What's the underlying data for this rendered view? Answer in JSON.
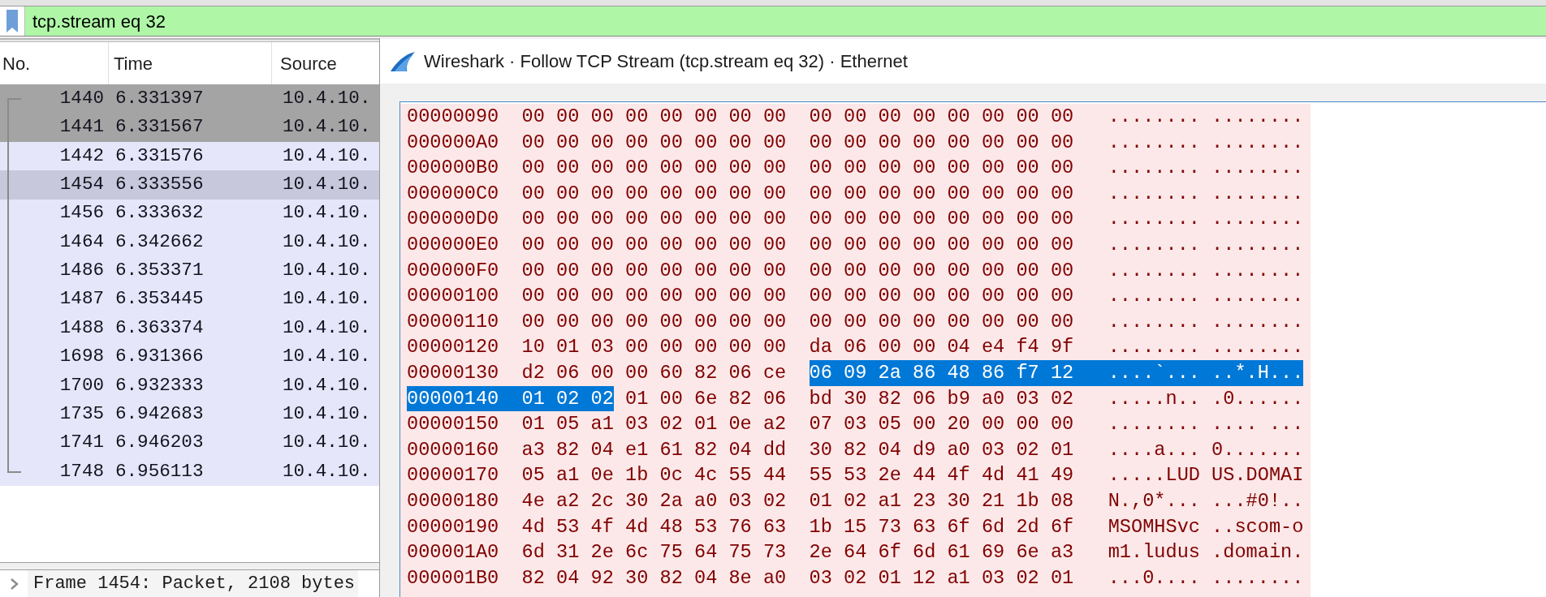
{
  "filter_bar": {
    "value": "tcp.stream eq 32"
  },
  "packet_list": {
    "columns": [
      "No.",
      "Time",
      "Source"
    ],
    "rows": [
      {
        "no": "1440",
        "time": "6.331397",
        "source": "10.4.10.",
        "color": "#a4a4a4"
      },
      {
        "no": "1441",
        "time": "6.331567",
        "source": "10.4.10.",
        "color": "#a4a4a4"
      },
      {
        "no": "1442",
        "time": "6.331576",
        "source": "10.4.10.",
        "color": "#e6e6fa"
      },
      {
        "no": "1454",
        "time": "6.333556",
        "source": "10.4.10.",
        "color": "#c8c8dc"
      },
      {
        "no": "1456",
        "time": "6.333632",
        "source": "10.4.10.",
        "color": "#e6e6fa"
      },
      {
        "no": "1464",
        "time": "6.342662",
        "source": "10.4.10.",
        "color": "#e6e6fa"
      },
      {
        "no": "1486",
        "time": "6.353371",
        "source": "10.4.10.",
        "color": "#e6e6fa"
      },
      {
        "no": "1487",
        "time": "6.353445",
        "source": "10.4.10.",
        "color": "#e6e6fa"
      },
      {
        "no": "1488",
        "time": "6.363374",
        "source": "10.4.10.",
        "color": "#e6e6fa"
      },
      {
        "no": "1698",
        "time": "6.931366",
        "source": "10.4.10.",
        "color": "#e6e6fa"
      },
      {
        "no": "1700",
        "time": "6.932333",
        "source": "10.4.10.",
        "color": "#e6e6fa"
      },
      {
        "no": "1735",
        "time": "6.942683",
        "source": "10.4.10.",
        "color": "#e6e6fa"
      },
      {
        "no": "1741",
        "time": "6.946203",
        "source": "10.4.10.",
        "color": "#e6e6fa"
      },
      {
        "no": "1748",
        "time": "6.956113",
        "source": "10.4.10.",
        "color": "#e6e6fa"
      }
    ]
  },
  "packet_details": {
    "items": [
      {
        "label": "Frame 1454: Packet, 2108 bytes",
        "expanded": false
      }
    ]
  },
  "follow_dialog": {
    "title": "Wireshark · Follow TCP Stream (tcp.stream eq 32) · Ethernet",
    "lines": [
      {
        "offset": {
          "text": "00000090",
          "selected": false
        },
        "hex_a": [
          {
            "text": "00 00 00 00 00 00 00 00",
            "selected": false
          }
        ],
        "hex_b": [
          {
            "text": "00 00 00 00 00 00 00 00",
            "selected": false
          }
        ],
        "ascii": [
          {
            "text": "........ ........",
            "selected": false
          }
        ]
      },
      {
        "offset": {
          "text": "000000A0",
          "selected": false
        },
        "hex_a": [
          {
            "text": "00 00 00 00 00 00 00 00",
            "selected": false
          }
        ],
        "hex_b": [
          {
            "text": "00 00 00 00 00 00 00 00",
            "selected": false
          }
        ],
        "ascii": [
          {
            "text": "........ ........",
            "selected": false
          }
        ]
      },
      {
        "offset": {
          "text": "000000B0",
          "selected": false
        },
        "hex_a": [
          {
            "text": "00 00 00 00 00 00 00 00",
            "selected": false
          }
        ],
        "hex_b": [
          {
            "text": "00 00 00 00 00 00 00 00",
            "selected": false
          }
        ],
        "ascii": [
          {
            "text": "........ ........",
            "selected": false
          }
        ]
      },
      {
        "offset": {
          "text": "000000C0",
          "selected": false
        },
        "hex_a": [
          {
            "text": "00 00 00 00 00 00 00 00",
            "selected": false
          }
        ],
        "hex_b": [
          {
            "text": "00 00 00 00 00 00 00 00",
            "selected": false
          }
        ],
        "ascii": [
          {
            "text": "........ ........",
            "selected": false
          }
        ]
      },
      {
        "offset": {
          "text": "000000D0",
          "selected": false
        },
        "hex_a": [
          {
            "text": "00 00 00 00 00 00 00 00",
            "selected": false
          }
        ],
        "hex_b": [
          {
            "text": "00 00 00 00 00 00 00 00",
            "selected": false
          }
        ],
        "ascii": [
          {
            "text": "........ ........",
            "selected": false
          }
        ]
      },
      {
        "offset": {
          "text": "000000E0",
          "selected": false
        },
        "hex_a": [
          {
            "text": "00 00 00 00 00 00 00 00",
            "selected": false
          }
        ],
        "hex_b": [
          {
            "text": "00 00 00 00 00 00 00 00",
            "selected": false
          }
        ],
        "ascii": [
          {
            "text": "........ ........",
            "selected": false
          }
        ]
      },
      {
        "offset": {
          "text": "000000F0",
          "selected": false
        },
        "hex_a": [
          {
            "text": "00 00 00 00 00 00 00 00",
            "selected": false
          }
        ],
        "hex_b": [
          {
            "text": "00 00 00 00 00 00 00 00",
            "selected": false
          }
        ],
        "ascii": [
          {
            "text": "........ ........",
            "selected": false
          }
        ]
      },
      {
        "offset": {
          "text": "00000100",
          "selected": false
        },
        "hex_a": [
          {
            "text": "00 00 00 00 00 00 00 00",
            "selected": false
          }
        ],
        "hex_b": [
          {
            "text": "00 00 00 00 00 00 00 00",
            "selected": false
          }
        ],
        "ascii": [
          {
            "text": "........ ........",
            "selected": false
          }
        ]
      },
      {
        "offset": {
          "text": "00000110",
          "selected": false
        },
        "hex_a": [
          {
            "text": "00 00 00 00 00 00 00 00",
            "selected": false
          }
        ],
        "hex_b": [
          {
            "text": "00 00 00 00 00 00 00 00",
            "selected": false
          }
        ],
        "ascii": [
          {
            "text": "........ ........",
            "selected": false
          }
        ]
      },
      {
        "offset": {
          "text": "00000120",
          "selected": false
        },
        "hex_a": [
          {
            "text": "10 01 03 00 00 00 00 00",
            "selected": false
          }
        ],
        "hex_b": [
          {
            "text": "da 06 00 00 04 e4 f4 9f",
            "selected": false
          }
        ],
        "ascii": [
          {
            "text": "........ ........",
            "selected": false
          }
        ]
      },
      {
        "offset": {
          "text": "00000130",
          "selected": false
        },
        "hex_a": [
          {
            "text": "d2 06 00 00 60 82 06 ce",
            "selected": false
          }
        ],
        "hex_b": [
          {
            "text": "06 09 2a 86 48 86 f7 12",
            "selected": true
          }
        ],
        "ascii": [
          {
            "text": "....`... ..*.H...",
            "selected": true
          }
        ]
      },
      {
        "offset": {
          "text": "00000140",
          "selected": true
        },
        "hex_a": [
          {
            "text": "01 02 02",
            "selected": true
          },
          {
            "text": "01 00 6e 82 06",
            "selected": false
          }
        ],
        "hex_b": [
          {
            "text": "bd 30 82 06 b9 a0 03 02",
            "selected": false
          }
        ],
        "ascii": [
          {
            "text": ".....n.. .0......",
            "selected": false
          }
        ]
      },
      {
        "offset": {
          "text": "00000150",
          "selected": false
        },
        "hex_a": [
          {
            "text": "01 05 a1 03 02 01 0e a2",
            "selected": false
          }
        ],
        "hex_b": [
          {
            "text": "07 03 05 00 20 00 00 00",
            "selected": false
          }
        ],
        "ascii": [
          {
            "text": "........ .... ...",
            "selected": false
          }
        ]
      },
      {
        "offset": {
          "text": "00000160",
          "selected": false
        },
        "hex_a": [
          {
            "text": "a3 82 04 e1 61 82 04 dd",
            "selected": false
          }
        ],
        "hex_b": [
          {
            "text": "30 82 04 d9 a0 03 02 01",
            "selected": false
          }
        ],
        "ascii": [
          {
            "text": "....a... 0.......",
            "selected": false
          }
        ]
      },
      {
        "offset": {
          "text": "00000170",
          "selected": false
        },
        "hex_a": [
          {
            "text": "05 a1 0e 1b 0c 4c 55 44",
            "selected": false
          }
        ],
        "hex_b": [
          {
            "text": "55 53 2e 44 4f 4d 41 49",
            "selected": false
          }
        ],
        "ascii": [
          {
            "text": ".....LUD US.DOMAI",
            "selected": false
          }
        ]
      },
      {
        "offset": {
          "text": "00000180",
          "selected": false
        },
        "hex_a": [
          {
            "text": "4e a2 2c 30 2a a0 03 02",
            "selected": false
          }
        ],
        "hex_b": [
          {
            "text": "01 02 a1 23 30 21 1b 08",
            "selected": false
          }
        ],
        "ascii": [
          {
            "text": "N.,0*... ...#0!..",
            "selected": false
          }
        ]
      },
      {
        "offset": {
          "text": "00000190",
          "selected": false
        },
        "hex_a": [
          {
            "text": "4d 53 4f 4d 48 53 76 63",
            "selected": false
          }
        ],
        "hex_b": [
          {
            "text": "1b 15 73 63 6f 6d 2d 6f",
            "selected": false
          }
        ],
        "ascii": [
          {
            "text": "MSOMHSvc ..scom-o",
            "selected": false
          }
        ]
      },
      {
        "offset": {
          "text": "000001A0",
          "selected": false
        },
        "hex_a": [
          {
            "text": "6d 31 2e 6c 75 64 75 73",
            "selected": false
          }
        ],
        "hex_b": [
          {
            "text": "2e 64 6f 6d 61 69 6e a3",
            "selected": false
          }
        ],
        "ascii": [
          {
            "text": "m1.ludus .domain.",
            "selected": false
          }
        ]
      },
      {
        "offset": {
          "text": "000001B0",
          "selected": false
        },
        "hex_a": [
          {
            "text": "82 04 92 30 82 04 8e a0",
            "selected": false
          }
        ],
        "hex_b": [
          {
            "text": "03 02 01 12 a1 03 02 01",
            "selected": false
          }
        ],
        "ascii": [
          {
            "text": "...0.... ........",
            "selected": false
          }
        ]
      }
    ]
  }
}
